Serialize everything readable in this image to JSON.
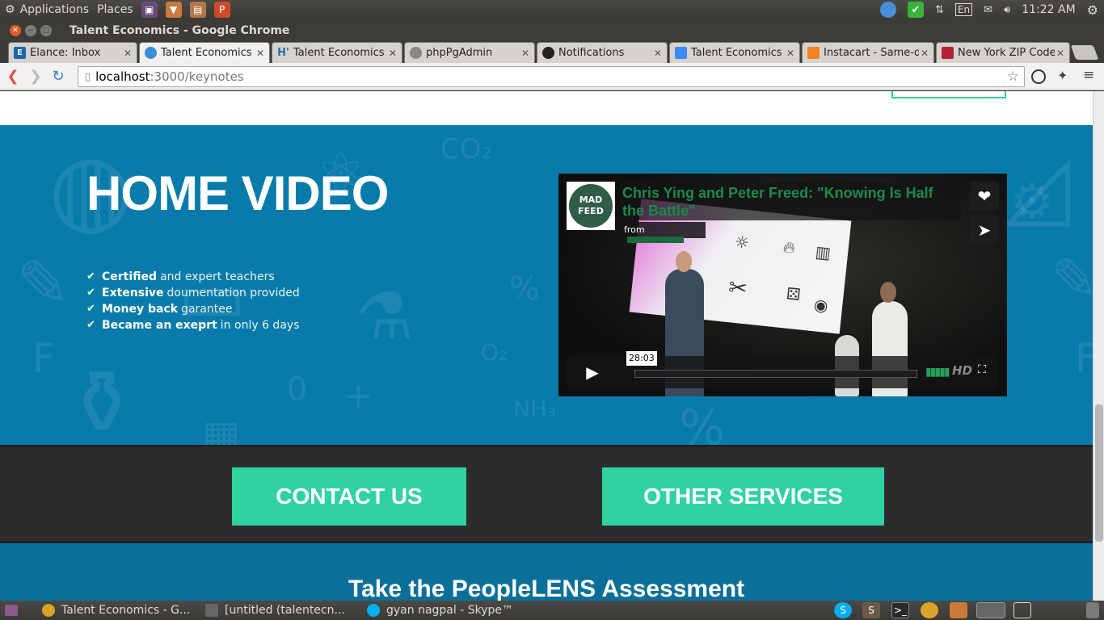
{
  "top_panel": {
    "menus": [
      "Applications",
      "Places"
    ],
    "keyboard_layout": "En",
    "clock": "11:22 AM"
  },
  "window": {
    "title": "Talent Economics - Google Chrome"
  },
  "tabs": [
    {
      "label": "Elance: Inbox",
      "favicon": "E",
      "color": "#1a66b3",
      "active": false
    },
    {
      "label": "Talent Economics",
      "favicon": "",
      "color": "#3a8fd6",
      "active": true
    },
    {
      "label": "Talent Economics",
      "favicon": "H'",
      "color": "#2b6da8",
      "active": false
    },
    {
      "label": "phpPgAdmin",
      "favicon": "",
      "color": "#888888",
      "active": false
    },
    {
      "label": "Notifications",
      "favicon": "",
      "color": "#222222",
      "active": false
    },
    {
      "label": "Talent Economics",
      "favicon": "",
      "color": "#3d8af7",
      "active": false
    },
    {
      "label": "Instacart - Same-da",
      "favicon": "",
      "color": "#f58220",
      "active": false
    },
    {
      "label": "New York ZIP Code",
      "favicon": "",
      "color": "#b22234",
      "active": false
    }
  ],
  "omnibox": {
    "host": "localhost",
    "path": ":3000/keynotes"
  },
  "hero": {
    "title": "HOME VIDEO",
    "features": [
      {
        "strong": "Certified",
        "rest": "and expert teachers"
      },
      {
        "strong": "Extensive",
        "rest": "doumentation provided"
      },
      {
        "strong": "Money back",
        "rest": "garantee"
      },
      {
        "strong": "Became an exeprt",
        "rest": "in only 6 days"
      }
    ]
  },
  "video": {
    "logo_line1": "MAD",
    "logo_line2": "FEED",
    "title": "Chris Ying and Peter Freed: \"Knowing Is Half the Battle\"",
    "from_label": "from",
    "duration": "28:03",
    "hd_label": "HD"
  },
  "cta": {
    "contact": "CONTACT US",
    "services": "OTHER SERVICES"
  },
  "assessment": {
    "title": "Take the PeopleLENS Assessment"
  },
  "taskbar": {
    "items": [
      "Talent Economics - G...",
      "[untitled (talentecn...",
      "gyan nagpal - Skype™"
    ]
  },
  "colors": {
    "hero_bg": "#087bab",
    "accent_green": "#2fd2a0",
    "dark_band": "#2b2c2b"
  }
}
